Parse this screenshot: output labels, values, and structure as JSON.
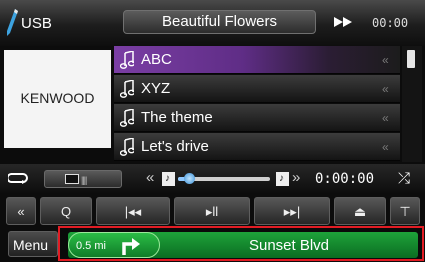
{
  "header": {
    "source": "USB",
    "title": "Beautiful Flowers",
    "clock": "00:00",
    "source_icon": "usb-pen-icon",
    "ff_icon": "fast-forward-icon"
  },
  "artwork": {
    "brand": "KENWOOD"
  },
  "tracklist": {
    "items": [
      {
        "label": "ABC",
        "selected": true
      },
      {
        "label": "XYZ",
        "selected": false
      },
      {
        "label": "The theme",
        "selected": false
      },
      {
        "label": "Let's drive",
        "selected": false
      }
    ],
    "item_arrow": "«"
  },
  "controls": {
    "repeat_icon": "repeat-icon",
    "skip_back": "«",
    "skip_forward": "»",
    "progress_fraction": 0.12,
    "time": "0:00:00",
    "shuffle_icon": "shuffle-icon",
    "shuffle": "⤮"
  },
  "buttons": [
    {
      "name": "back-button",
      "glyph": "«"
    },
    {
      "name": "search-button",
      "glyph": "Q"
    },
    {
      "name": "previous-button",
      "glyph": "|◂◂"
    },
    {
      "name": "play-pause-button",
      "glyph": "▸ll"
    },
    {
      "name": "next-button",
      "glyph": "▸▸|"
    },
    {
      "name": "eject-button",
      "glyph": "⏏"
    },
    {
      "name": "up-button",
      "glyph": "⊤"
    }
  ],
  "bottom": {
    "menu": "Menu",
    "nav": {
      "distance": "0.5 mi",
      "street": "Sunset Blvd",
      "turn_icon": "turn-right-icon"
    }
  },
  "colors": {
    "selection": "#7a3ea4",
    "nav_green": "#1ea33a",
    "highlight_border": "#e21c24",
    "progress": "#3a8fd6"
  }
}
